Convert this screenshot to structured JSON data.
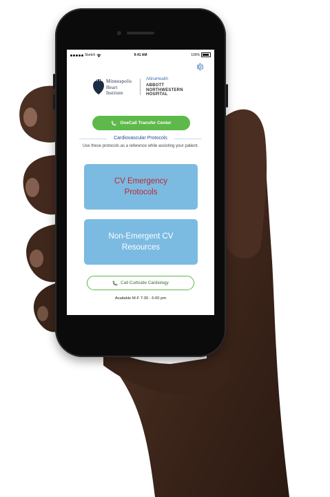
{
  "status_bar": {
    "carrier": "Sketch",
    "time": "9:41 AM",
    "battery": "100%"
  },
  "header": {
    "settings_icon": "gear-icon",
    "mhi_logo_lines": [
      "Minneapolis",
      "Heart",
      "Institute"
    ],
    "allina_logo": "AllinaHealth",
    "abbott_logo_lines": [
      "ABBOTT",
      "NORTHWESTERN",
      "HOSPITAL"
    ]
  },
  "onecall_button": {
    "label": "OneCall Transfer Center",
    "icon": "phone-icon"
  },
  "protocols_section": {
    "title": "Cardiovascular Protocols",
    "subtitle": "Use these protocols as a reference while assisting your patient."
  },
  "cards": {
    "emergency_label": "CV Emergency Protocols",
    "nonemergent_label": "Non-Emergent CV Resources"
  },
  "curbside_button": {
    "label": "Call Curbside Cardiology",
    "icon": "phone-icon"
  },
  "availability": "Available M-F 7:30 - 5:00 pm",
  "colors": {
    "green": "#5db94a",
    "card_blue": "#7bbbe2",
    "emergency_red": "#c0262e",
    "title_blue": "#1f4a8c"
  }
}
